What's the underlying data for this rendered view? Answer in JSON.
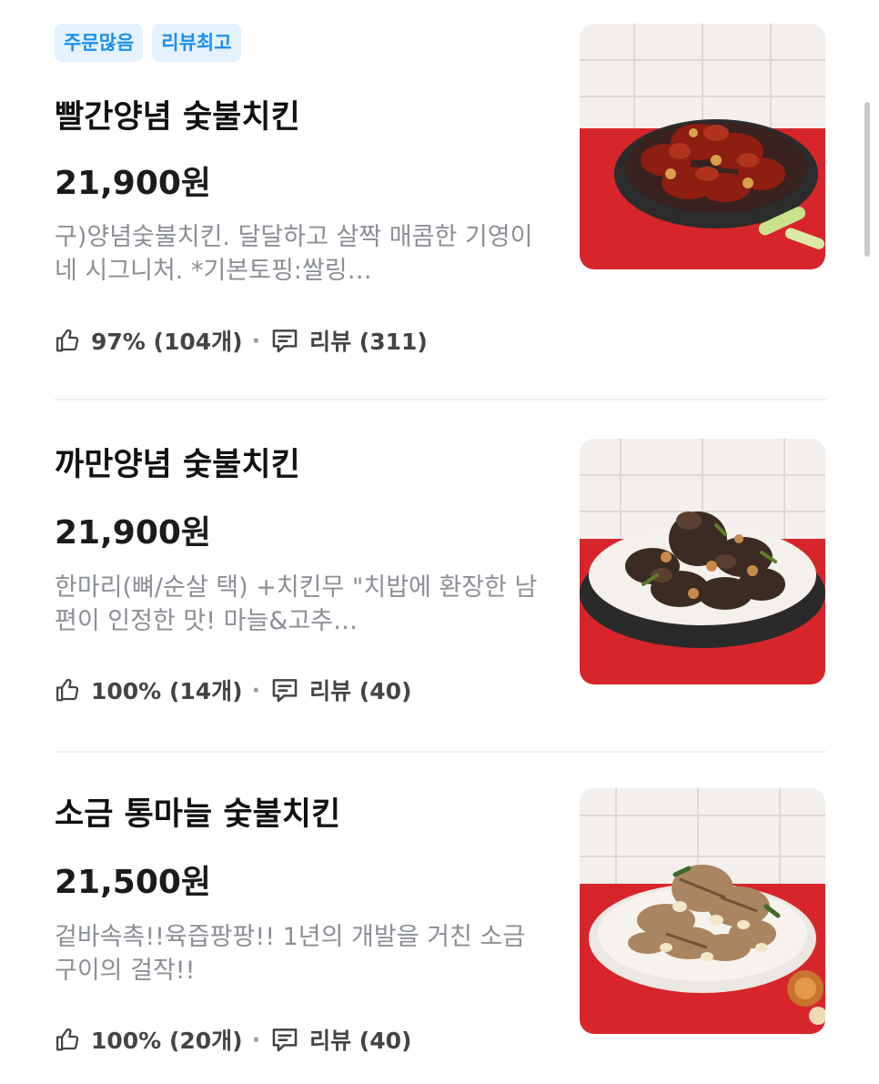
{
  "menu": {
    "items": [
      {
        "badges": [
          "주문많음",
          "리뷰최고"
        ],
        "name": "빨간양념 숯불치킨",
        "price": "21,900원",
        "description": "구)양념숯불치킨. 달달하고 살짝 매콤한 기영이네 시그니처. *기본토핑:쌀링…",
        "like_text": "97% (104개)",
        "review_text": "리뷰 (311)",
        "photo_icon": "red-sauce-chicken-photo"
      },
      {
        "name": "까만양념 숯불치킨",
        "price": "21,900원",
        "description": "한마리(뼈/순살 택) +치킨무     \"치밥에 환장한 남편이 인정한 맛! 마늘&고추…",
        "like_text": "100% (14개)",
        "review_text": "리뷰 (40)",
        "photo_icon": "black-sauce-chicken-photo"
      },
      {
        "name": "소금 통마늘 숯불치킨",
        "price": "21,500원",
        "description": "겉바속촉!!육즙팡팡!! 1년의 개발을 거친 소금구이의 걸작!!",
        "like_text": "100% (20개)",
        "review_text": "리뷰 (40)",
        "photo_icon": "salt-garlic-chicken-photo"
      }
    ],
    "separator": "·"
  },
  "colors": {
    "badge_bg": "#e3f2fe",
    "badge_text": "#1d8ef0",
    "price_text": "#1b1b1b",
    "description_text": "#8b8f96",
    "photo_table_red": "#d7262b",
    "photo_wall_tile": "#f2efec"
  }
}
